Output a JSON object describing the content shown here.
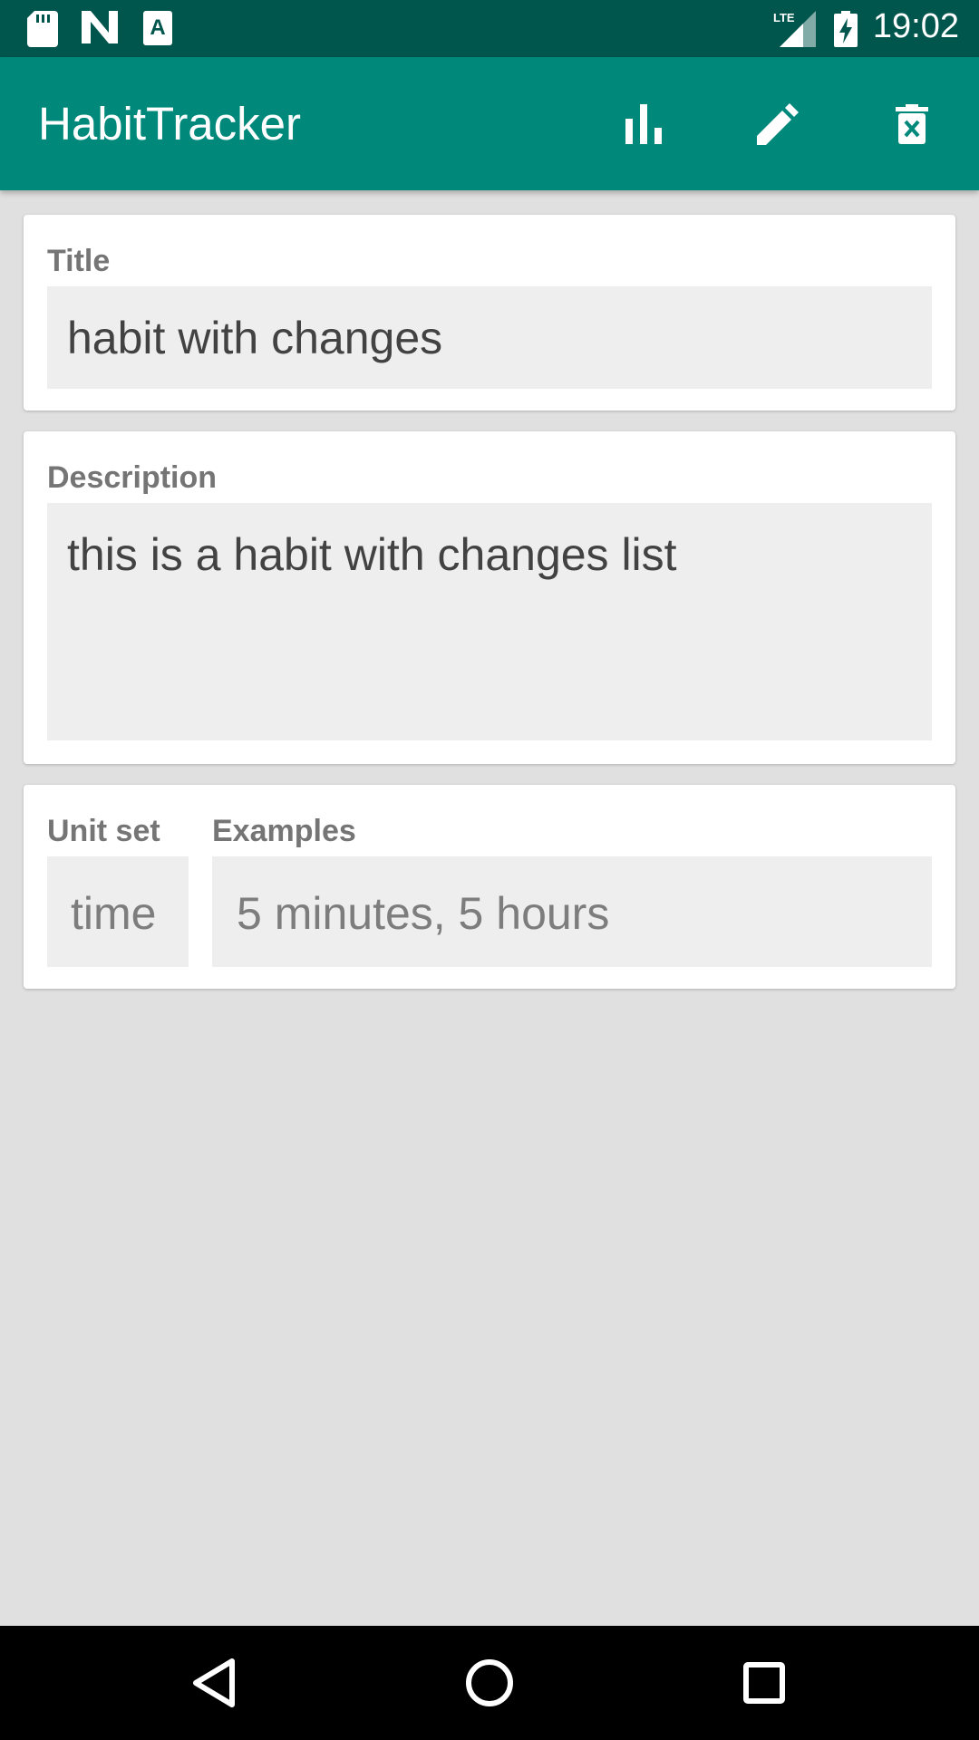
{
  "status_bar": {
    "time": "19:02",
    "icons": [
      "sd-card-icon",
      "n-icon",
      "a-text-icon",
      "lte-signal-icon",
      "battery-charging-icon"
    ],
    "network_label": "LTE"
  },
  "app_bar": {
    "title": "HabitTracker",
    "actions": [
      "bar-chart-icon",
      "edit-icon",
      "delete-icon"
    ],
    "color": "#00897b",
    "status_color": "#00564d"
  },
  "form": {
    "title_label": "Title",
    "title_value": "habit with changes",
    "description_label": "Description",
    "description_value": "this is a habit with changes list",
    "unit_set_label": "Unit set",
    "unit_set_value": "time",
    "examples_label": "Examples",
    "examples_value": "5 minutes, 5 hours"
  },
  "nav_bar": {
    "buttons": [
      "back-icon",
      "home-icon",
      "recents-icon"
    ]
  }
}
